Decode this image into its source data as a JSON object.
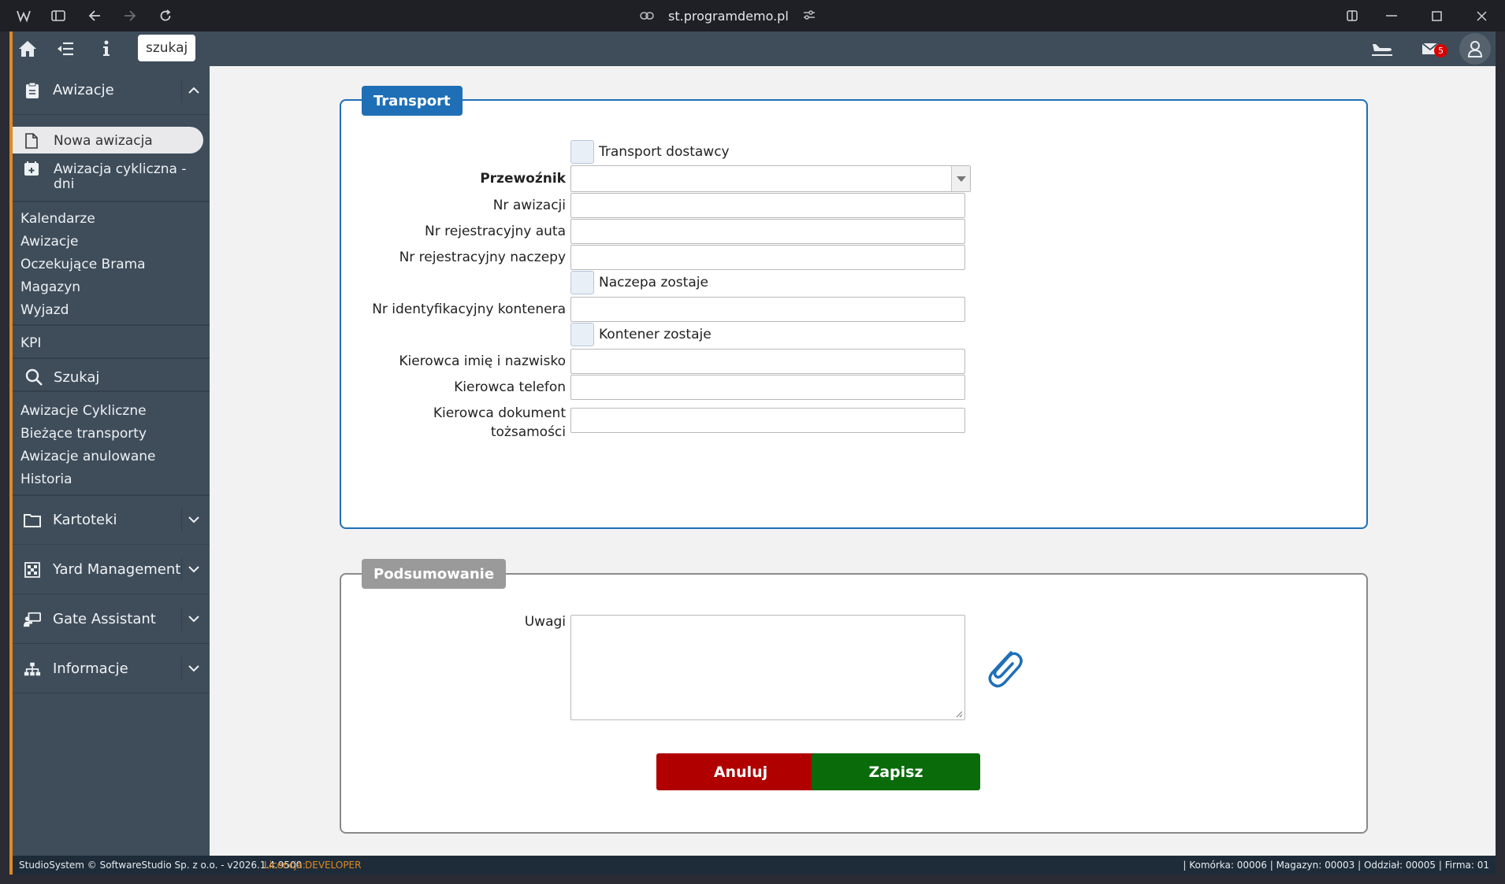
{
  "browser": {
    "url": "st.programdemo.pl"
  },
  "topbar": {
    "search_label": "szukaj",
    "mail_count": "5"
  },
  "sidebar": {
    "awizacje_header": "Awizacje",
    "sub_items": [
      "Nowa awizacja",
      "Awizacja cykliczna - dni"
    ],
    "group1": [
      "Kalendarze",
      "Awizacje",
      "Oczekujące Brama",
      "Magazyn",
      "Wyjazd"
    ],
    "kpi": "KPI",
    "szukaj_header": "Szukaj",
    "group2": [
      "Awizacje Cykliczne",
      "Bieżące transporty",
      "Awizacje anulowane",
      "Historia"
    ],
    "kartoteki": "Kartoteki",
    "yard": "Yard Management",
    "gate": "Gate Assistant",
    "informacje": "Informacje"
  },
  "transport": {
    "legend": "Transport",
    "transport_dostawcy": "Transport dostawcy",
    "przewoznik": "Przewoźnik",
    "nr_awizacji": "Nr awizacji",
    "nr_rej_auta": "Nr rejestracyjny auta",
    "nr_rej_naczepy": "Nr rejestracyjny naczepy",
    "naczepa_zostaje": "Naczepa zostaje",
    "nr_kontenera": "Nr identyfikacyjny kontenera",
    "kontener_zostaje": "Kontener zostaje",
    "kierowca_imie": "Kierowca imię i nazwisko",
    "kierowca_telefon": "Kierowca telefon",
    "kierowca_dokument_1": "Kierowca dokument",
    "kierowca_dokument_2": "tożsamości"
  },
  "summary": {
    "legend": "Podsumowanie",
    "uwagi": "Uwagi",
    "anuluj": "Anuluj",
    "zapisz": "Zapisz"
  },
  "status": {
    "copyright": "StudioSystem © SoftwareStudio Sp. z o.o. - v2026.1.4.9500",
    "licencja_label": "Licencja:",
    "licencja_value": "DEVELOPER",
    "right": "| Komórka: 00006 | Magazyn: 00003 | Oddział: 00005 | Firma: 01"
  },
  "colors": {
    "accent": "#1f6fb6",
    "sidebar": "#3f4d5b",
    "cancel": "#b00000",
    "save": "#0a6b0a",
    "frame_accent": "#e08a1e"
  }
}
